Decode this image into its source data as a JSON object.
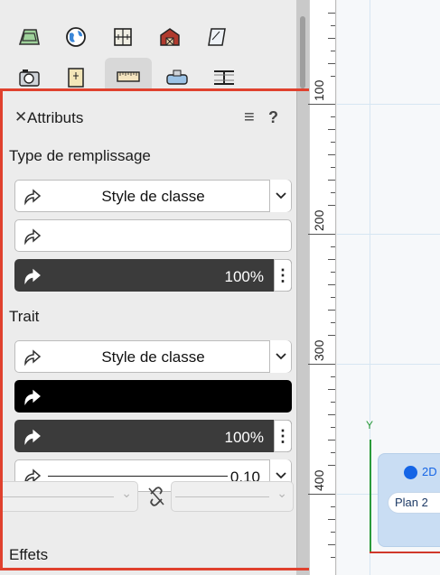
{
  "palette": {
    "tools": [
      {
        "name": "site-tool-icon"
      },
      {
        "name": "globe-tool-icon"
      },
      {
        "name": "window-tool-icon"
      },
      {
        "name": "barn-tool-icon"
      },
      {
        "name": "landscape-tool-icon"
      },
      {
        "name": "camera-tool-icon"
      },
      {
        "name": "door-tool-icon"
      },
      {
        "name": "ruler-tool-icon",
        "selected": true
      },
      {
        "name": "pipe-tool-icon"
      },
      {
        "name": "beam-tool-icon"
      }
    ]
  },
  "attributes": {
    "title": "Attributs",
    "close": "✕",
    "menu": "≡",
    "help": "?",
    "fill": {
      "section": "Type de remplissage",
      "style_label": "Style de classe",
      "opacity": "100%"
    },
    "stroke": {
      "section": "Trait",
      "style_label": "Style de classe",
      "opacity": "100%",
      "line_weight": "0.10"
    },
    "effects": {
      "section": "Effets"
    },
    "colors": {
      "accent_border": "#e0412e",
      "opacity_bar": "#3b3b3b",
      "stroke_color": "#000000"
    }
  },
  "ruler": {
    "labels": [
      "100",
      "200",
      "300",
      "400"
    ]
  },
  "canvas": {
    "axis_y_label": "Y",
    "view_label": "2D",
    "plane_label": "Plan 2",
    "colors": {
      "axis_y": "#2a9a3a",
      "axis_x": "#d0382a",
      "view_dot": "#1565e6"
    }
  }
}
